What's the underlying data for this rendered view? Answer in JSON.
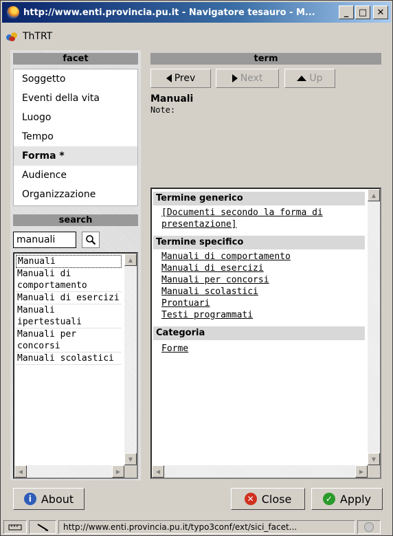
{
  "window": {
    "title": "http://www.enti.provincia.pu.it - Navigatore tesauro - M...",
    "controls": {
      "minimize": "_",
      "maximize": "□",
      "close": "✕"
    }
  },
  "app": {
    "name": "ThTRT"
  },
  "facet": {
    "header": "facet",
    "items": [
      "Soggetto",
      "Eventi della vita",
      "Luogo",
      "Tempo",
      "Forma *",
      "Audience",
      "Organizzazione"
    ],
    "selected_index": 4
  },
  "search": {
    "header": "search",
    "input_value": "manuali",
    "results": [
      "Manuali",
      "Manuali di comportamento",
      "Manuali di esercizi",
      "Manuali ipertestuali",
      "Manuali per concorsi",
      "Manuali scolastici"
    ]
  },
  "term": {
    "header": "term",
    "nav": {
      "prev": "Prev",
      "next": "Next",
      "up": "Up"
    },
    "title": "Manuali",
    "note_label": "Note:",
    "sections": [
      {
        "heading": "Termine generico",
        "links": [
          "[Documenti secondo la forma di presentazione]"
        ]
      },
      {
        "heading": "Termine specifico",
        "links": [
          "Manuali di comportamento",
          "Manuali di esercizi",
          "Manuali per concorsi",
          "Manuali scolastici",
          "Prontuari",
          "Testi programmati"
        ]
      },
      {
        "heading": "Categoria",
        "links": [
          "Forme"
        ]
      }
    ]
  },
  "buttons": {
    "about": "About",
    "close": "Close",
    "apply": "Apply"
  },
  "status": {
    "url": "http://www.enti.provincia.pu.it/typo3conf/ext/sici_facet..."
  },
  "colors": {
    "title_bar": "#0a246a",
    "section_header": "#999999",
    "close_icon": "#d03020",
    "apply_icon": "#2a9a2a",
    "about_icon": "#2e5cb8"
  }
}
